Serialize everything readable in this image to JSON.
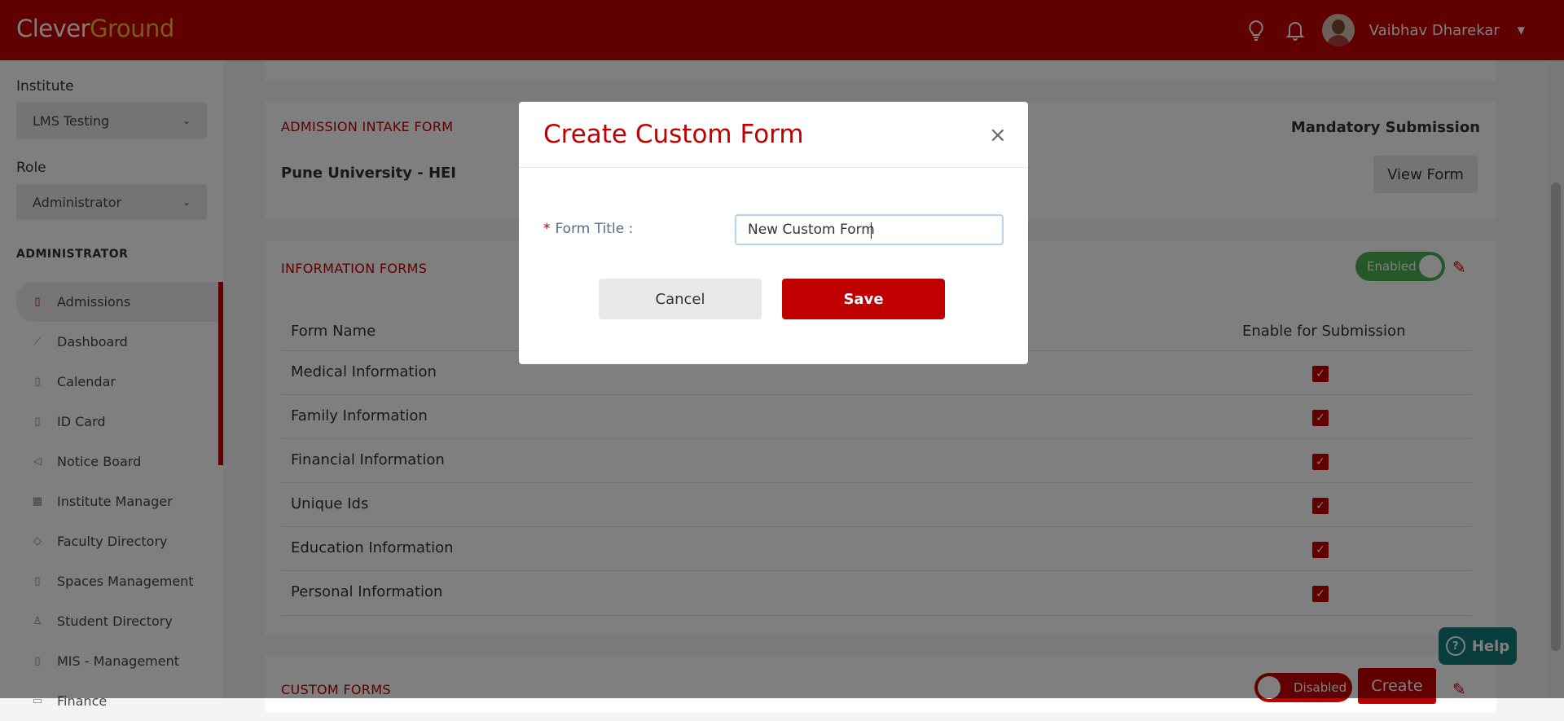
{
  "header": {
    "logo_part1": "Clever",
    "logo_part2": "Ground",
    "user_name": "Vaibhav Dharekar",
    "icons": [
      "lightbulb-icon",
      "bell-icon",
      "avatar",
      "caret-down-icon"
    ]
  },
  "sidebar": {
    "institute_label": "Institute",
    "institute_value": "LMS Testing",
    "role_label": "Role",
    "role_value": "Administrator",
    "section_heading": "ADMINISTRATOR",
    "items": [
      {
        "label": "Admissions",
        "icon": "book-icon",
        "active": true
      },
      {
        "label": "Dashboard",
        "icon": "chart-line-icon"
      },
      {
        "label": "Calendar",
        "icon": "book-icon"
      },
      {
        "label": "ID Card",
        "icon": "book-icon"
      },
      {
        "label": "Notice Board",
        "icon": "megaphone-icon"
      },
      {
        "label": "Institute Manager",
        "icon": "calendar-grid-icon"
      },
      {
        "label": "Faculty Directory",
        "icon": "graduation-cap-icon"
      },
      {
        "label": "Spaces Management",
        "icon": "book-icon"
      },
      {
        "label": "Student Directory",
        "icon": "person-icon"
      },
      {
        "label": "MIS - Management",
        "icon": "book-icon"
      },
      {
        "label": "Finance",
        "icon": "folder-icon"
      }
    ]
  },
  "admission_card": {
    "title": "ADMISSION INTAKE FORM",
    "subtitle": "Pune University - HEI",
    "right_label": "Mandatory Submission",
    "view_button": "View Form"
  },
  "information_forms": {
    "title": "INFORMATION FORMS",
    "toggle_label": "Enabled",
    "col_name": "Form Name",
    "col_enable": "Enable for Submission",
    "rows": [
      {
        "name": "Medical Information",
        "checked": true
      },
      {
        "name": "Family Information",
        "checked": true
      },
      {
        "name": "Financial Information",
        "checked": true
      },
      {
        "name": "Unique Ids",
        "checked": true
      },
      {
        "name": "Education Information",
        "checked": true
      },
      {
        "name": "Personal Information",
        "checked": true
      }
    ]
  },
  "custom_forms": {
    "title": "CUSTOM FORMS",
    "toggle_label": "Disabled",
    "create_button": "Create"
  },
  "help_button": "Help",
  "modal": {
    "title": "Create Custom Form",
    "close": "×",
    "field_label": "Form Title",
    "required_marker": "*",
    "field_value": "New Custom Form",
    "cancel": "Cancel",
    "save": "Save"
  },
  "colors": {
    "brand": "#c00000",
    "logo_accent": "#f0b63a",
    "toggle_on": "#4caf50",
    "help": "#147b7b"
  }
}
